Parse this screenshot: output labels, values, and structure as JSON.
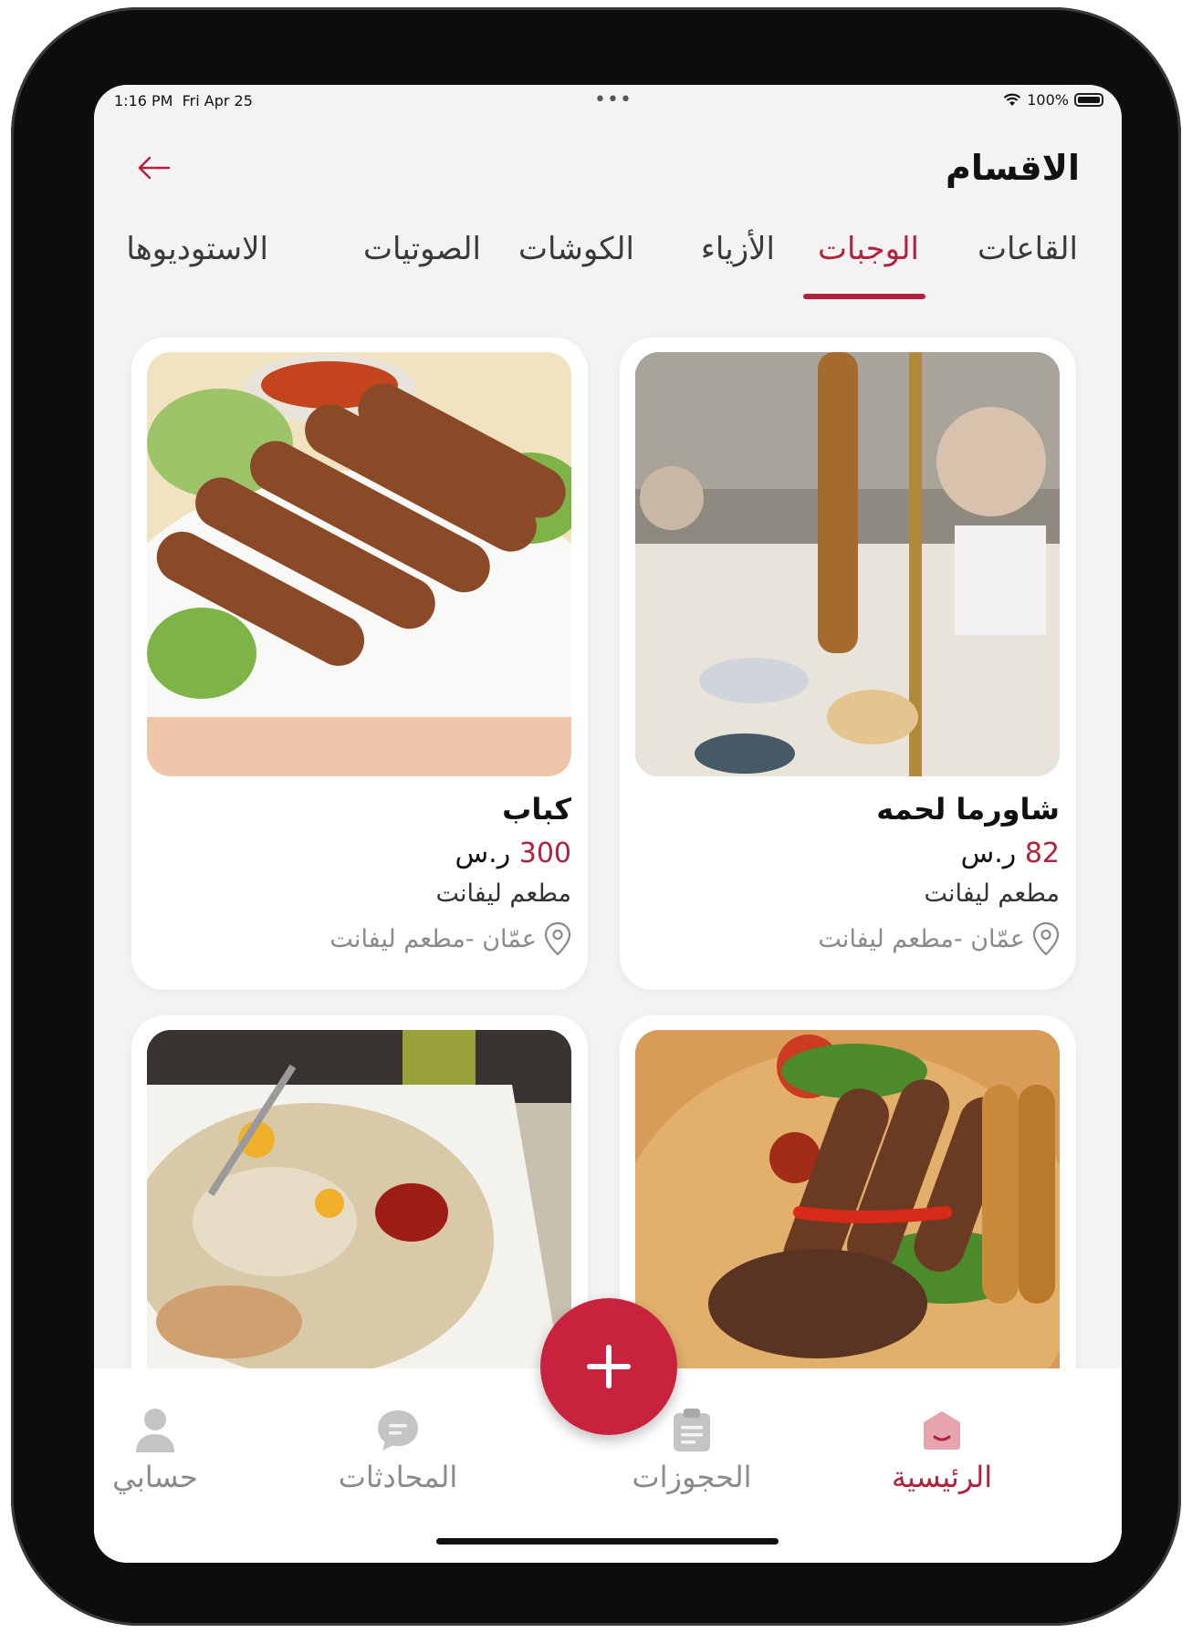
{
  "status_bar": {
    "time": "1:16 PM",
    "date": "Fri Apr 25",
    "battery": "100%"
  },
  "header": {
    "title": "الاقسام"
  },
  "tabs": [
    {
      "label": "القاعات",
      "active": false
    },
    {
      "label": "الوجبات",
      "active": true
    },
    {
      "label": "الأزياء",
      "active": false
    },
    {
      "label": "الكوشات",
      "active": false
    },
    {
      "label": "الصوتيات",
      "active": false
    },
    {
      "label": "الاستوديوها",
      "active": false
    }
  ],
  "cards": [
    {
      "title": "شاورما لحمه",
      "price": "82",
      "currency": "ر.س",
      "restaurant": "مطعم ليفانت",
      "location": "عمّان -مطعم ليفانت"
    },
    {
      "title": "كباب",
      "price": "300",
      "currency": "ر.س",
      "restaurant": "مطعم ليفانت",
      "location": "عمّان -مطعم ليفانت"
    },
    {
      "title": "",
      "price": "",
      "currency": "",
      "restaurant": "",
      "location": ""
    },
    {
      "title": "",
      "price": "",
      "currency": "",
      "restaurant": "",
      "location": ""
    }
  ],
  "bottom_nav": [
    {
      "label": "الرئيسية",
      "icon": "home-icon",
      "active": true
    },
    {
      "label": "الحجوزات",
      "icon": "clipboard-icon",
      "active": false
    },
    {
      "label": "المحادثات",
      "icon": "chat-icon",
      "active": false
    },
    {
      "label": "حسابي",
      "icon": "profile-icon",
      "active": false
    }
  ],
  "colors": {
    "accent": "#b2223c",
    "fab": "#c8223f",
    "background": "#f3f3f3"
  }
}
